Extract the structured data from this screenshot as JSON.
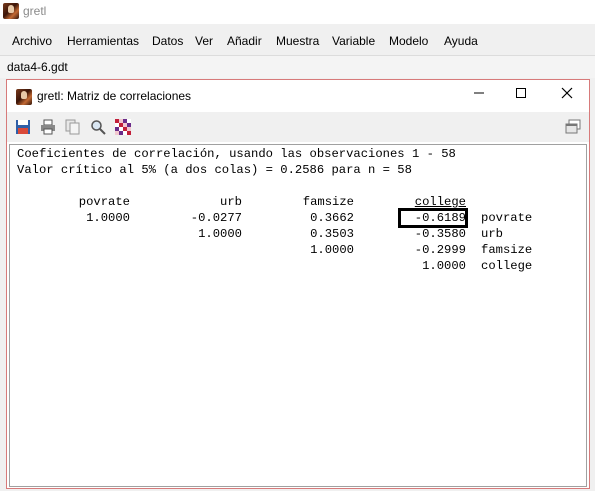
{
  "app": {
    "title": "gretl"
  },
  "menu": {
    "items": [
      "Archivo",
      "Herramientas",
      "Datos",
      "Ver",
      "Añadir",
      "Muestra",
      "Variable",
      "Modelo",
      "Ayuda"
    ]
  },
  "dataset": {
    "name": "data4-6.gdt"
  },
  "window": {
    "title": "gretl: Matriz de correlaciones",
    "minimize": "—",
    "maximize": "☐",
    "close": "✕"
  },
  "toolbar": {
    "icons": [
      "save-icon",
      "print-icon",
      "copy-icon",
      "find-icon",
      "heatmap-icon",
      "restore-icon"
    ]
  },
  "output": {
    "line1": "Coeficientes de correlación, usando las observaciones 1 - 58",
    "line2": "Valor crítico al 5% (a dos colas) = 0.2586 para n = 58",
    "headers": [
      "povrate",
      "urb",
      "famsize",
      "college"
    ],
    "rows": [
      {
        "values": [
          "1.0000",
          "-0.0277",
          "0.3662",
          "-0.6189"
        ],
        "label": "povrate"
      },
      {
        "values": [
          "",
          "1.0000",
          "0.3503",
          "-0.3580"
        ],
        "label": "urb"
      },
      {
        "values": [
          "",
          "",
          "1.0000",
          "-0.2999"
        ],
        "label": "famsize"
      },
      {
        "values": [
          "",
          "",
          "",
          "1.0000"
        ],
        "label": "college"
      }
    ],
    "highlighted_cell": "-0.6189"
  }
}
